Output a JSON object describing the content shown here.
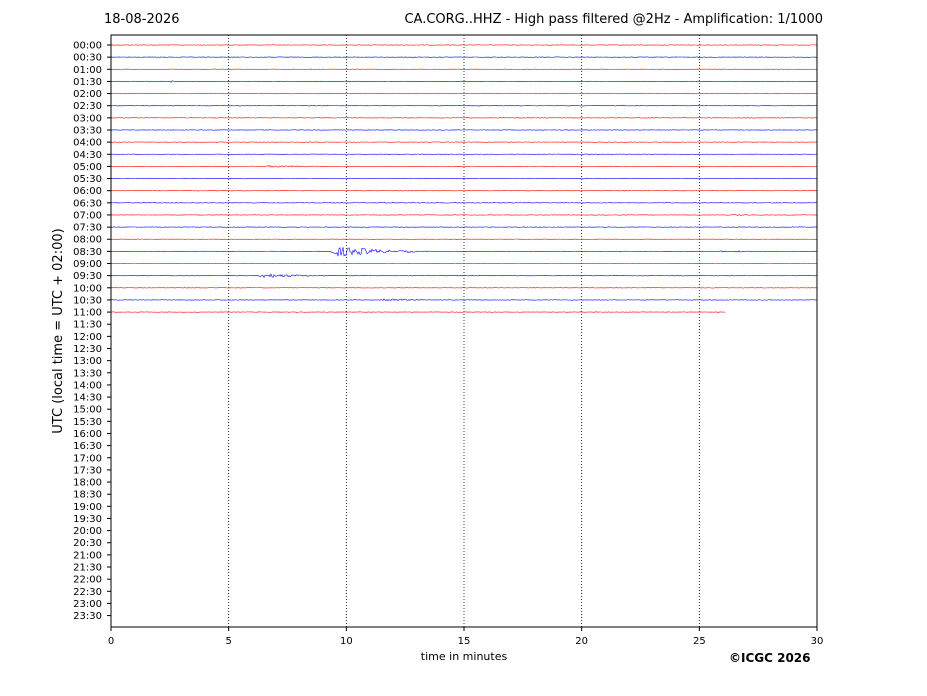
{
  "header": {
    "date": "18-08-2026",
    "title": "CA.CORG..HHZ - High pass filtered @2Hz - Amplification: 1/1000"
  },
  "footer": {
    "copyright": "©ICGC 2026"
  },
  "chart_data": {
    "type": "line",
    "title": "CA.CORG..HHZ - High pass filtered @2Hz - Amplification: 1/1000",
    "xlabel": "time in minutes",
    "ylabel": "UTC (local time = UTC + 02:00)",
    "xlim": [
      0,
      30
    ],
    "x_ticks": [
      0,
      5,
      10,
      15,
      20,
      25,
      30
    ],
    "grid": "vertical dotted at each 5 minutes",
    "row_labels": [
      "00:00",
      "00:30",
      "01:00",
      "01:30",
      "02:00",
      "02:30",
      "03:00",
      "03:30",
      "04:00",
      "04:30",
      "05:00",
      "05:30",
      "06:00",
      "06:30",
      "07:00",
      "07:30",
      "08:00",
      "08:30",
      "09:00",
      "09:30",
      "10:00",
      "10:30",
      "11:00",
      "11:30",
      "12:00",
      "12:30",
      "13:00",
      "13:30",
      "14:00",
      "14:30",
      "15:00",
      "15:30",
      "16:00",
      "16:30",
      "17:00",
      "17:30",
      "18:00",
      "18:30",
      "19:00",
      "19:30",
      "20:00",
      "20:30",
      "21:00",
      "21:30",
      "22:00",
      "22:30",
      "23:00",
      "23:30"
    ],
    "trace_colors": [
      "#ff0000",
      "#0000ff"
    ],
    "traces": [
      {
        "row": "00:00",
        "end_minute": 30,
        "events": []
      },
      {
        "row": "00:30",
        "end_minute": 30,
        "events": []
      },
      {
        "row": "01:00",
        "end_minute": 30,
        "events": []
      },
      {
        "row": "01:30",
        "end_minute": 30,
        "events": [
          {
            "start": 2.5,
            "end": 2.8,
            "amplitude": 1
          }
        ]
      },
      {
        "row": "02:00",
        "end_minute": 30,
        "events": []
      },
      {
        "row": "02:30",
        "end_minute": 30,
        "events": []
      },
      {
        "row": "03:00",
        "end_minute": 30,
        "events": []
      },
      {
        "row": "03:30",
        "end_minute": 30,
        "events": []
      },
      {
        "row": "04:00",
        "end_minute": 30,
        "events": []
      },
      {
        "row": "04:30",
        "end_minute": 30,
        "events": []
      },
      {
        "row": "05:00",
        "end_minute": 30,
        "events": [
          {
            "start": 6.3,
            "end": 10.2,
            "amplitude": 1
          }
        ]
      },
      {
        "row": "05:30",
        "end_minute": 30,
        "events": []
      },
      {
        "row": "06:00",
        "end_minute": 30,
        "events": []
      },
      {
        "row": "06:30",
        "end_minute": 30,
        "events": []
      },
      {
        "row": "07:00",
        "end_minute": 30,
        "events": [
          {
            "start": 26.3,
            "end": 27.5,
            "amplitude": 1
          }
        ]
      },
      {
        "row": "07:30",
        "end_minute": 30,
        "events": []
      },
      {
        "row": "08:00",
        "end_minute": 30,
        "events": []
      },
      {
        "row": "08:30",
        "end_minute": 30,
        "events": [
          {
            "start": 9.3,
            "end": 12.5,
            "amplitude": 5
          },
          {
            "start": 12.5,
            "end": 13.2,
            "amplitude": 1.5
          },
          {
            "start": 25.8,
            "end": 26.2,
            "amplitude": 1
          },
          {
            "start": 26.5,
            "end": 27.2,
            "amplitude": 1
          }
        ]
      },
      {
        "row": "09:00",
        "end_minute": 30,
        "events": []
      },
      {
        "row": "09:30",
        "end_minute": 30,
        "events": [
          {
            "start": 6.2,
            "end": 9.1,
            "amplitude": 2
          }
        ]
      },
      {
        "row": "10:00",
        "end_minute": 30,
        "events": []
      },
      {
        "row": "10:30",
        "end_minute": 30,
        "events": [
          {
            "start": 11.3,
            "end": 13.8,
            "amplitude": 1.5
          }
        ]
      },
      {
        "row": "11:00",
        "end_minute": 26.1,
        "events": []
      }
    ]
  }
}
